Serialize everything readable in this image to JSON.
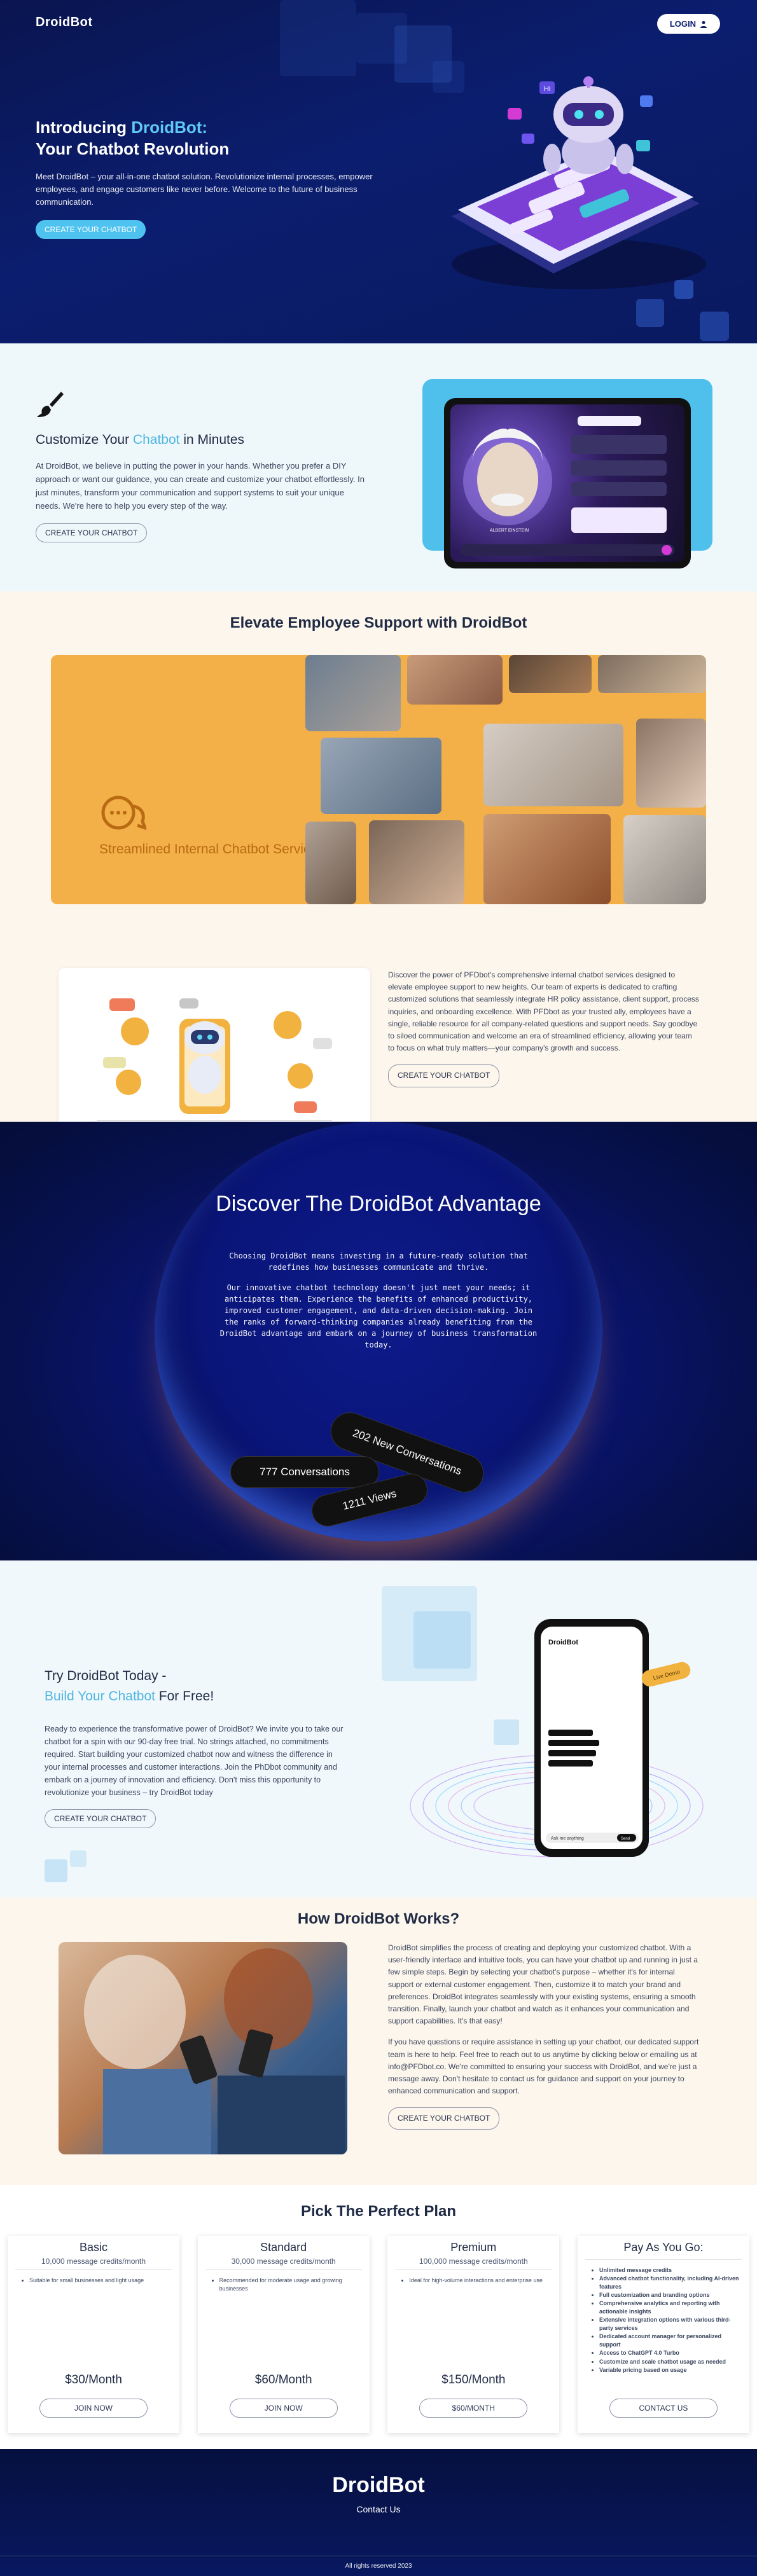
{
  "header": {
    "brand": "DroidBot",
    "login_label": "LOGIN",
    "login_icon": "user-icon"
  },
  "hero": {
    "title_line1_prefix": "Introducing ",
    "title_line1_accent": "DroidBot:",
    "title_line2": "Your Chatbot Revolution",
    "description": "Meet DroidBot – your all-in-one chatbot solution. Revolutionize internal processes, empower employees, and engage customers like never before. Welcome to the future of business communication.",
    "cta_label": "CREATE YOUR CHATBOT",
    "chat_badge": "Hi"
  },
  "customize": {
    "title_prefix": "Customize Your ",
    "title_accent": "Chatbot",
    "title_suffix": " in Minutes",
    "description": "At DroidBot, we believe in putting the power in your hands. Whether you prefer a DIY approach or want our guidance, you can create and customize your chatbot effortlessly. In just minutes, transform your communication and support systems to suit your unique needs. We're here to help you every step of the way.",
    "cta_label": "CREATE YOUR CHATBOT",
    "mock_name": "ALBERT EINSTEIN"
  },
  "elevate": {
    "title": "Elevate Employee Support with DroidBot",
    "card_title": "Streamlined Internal Chatbot Services",
    "description": "Discover the power of PFDbot's comprehensive internal chatbot services designed to elevate employee support to new heights. Our team of experts is dedicated to crafting customized solutions that seamlessly integrate HR policy assistance, client support, process inquiries, and onboarding excellence. With PFDbot as your trusted ally, employees have a single, reliable resource for all company-related questions and support needs. Say goodbye to siloed communication and welcome an era of streamlined efficiency, allowing your team to focus on what truly matters—your company's growth and success.",
    "cta_label": "CREATE YOUR CHATBOT"
  },
  "discover": {
    "title": "Discover The DroidBot Advantage",
    "paragraph1": "Choosing DroidBot means investing in a future-ready solution that redefines how businesses communicate and thrive.",
    "paragraph2": "Our innovative chatbot technology doesn't just meet your needs; it anticipates them. Experience the benefits of enhanced productivity, improved customer engagement, and data-driven decision-making. Join the ranks of forward-thinking companies already benefiting from the DroidBot advantage and embark on a journey of business transformation today.",
    "stat_conversations": "202 New Conversations",
    "stat_total": "777 Conversations",
    "stat_views": "1211 Views"
  },
  "try": {
    "title_line1": "Try DroidBot Today -",
    "title_accent": "Build Your Chatbot",
    "title_suffix": " For Free!",
    "description": "Ready to experience the transformative power of DroidBot? We invite you to take our chatbot for a spin with our 90-day free trial. No strings attached, no commitments required. Start building your customized chatbot now and witness the difference in your internal processes and customer interactions. Join the PhDbot community and embark on a journey of innovation and efficiency. Don't miss this opportunity to revolutionize your business – try DroidBot today",
    "cta_label": "CREATE YOUR CHATBOT",
    "phone_brand": "DroidBot",
    "phone_badge": "Live Demo",
    "phone_input": "Ask me anything",
    "phone_send": "Send"
  },
  "how": {
    "title": "How DroidBot Works?",
    "paragraph1": "DroidBot simplifies the process of creating and deploying your customized chatbot. With a user-friendly interface and intuitive tools, you can have your chatbot up and running in just a few simple steps. Begin by selecting your chatbot's purpose – whether it's for internal support or external customer engagement. Then, customize it to match your brand and preferences. DroidBot integrates seamlessly with your existing systems, ensuring a smooth transition. Finally, launch your chatbot and watch as it enhances your communication and support capabilities. It's that easy!",
    "paragraph2": "If you have questions or require assistance in setting up your chatbot, our dedicated support team is here to help. Feel free to reach out to us anytime by clicking below or emailing us at info@PFDbot.co. We're committed to ensuring your success with DroidBot, and we're just a message away. Don't hesitate to contact us for guidance and support on your journey to enhanced communication and support.",
    "cta_label": "CREATE YOUR CHATBOT"
  },
  "pricing": {
    "title": "Pick The Perfect Plan",
    "plans": [
      {
        "name": "Basic",
        "credits": "10,000 message credits/month",
        "features": [
          "Suitable for small businesses and light usage"
        ],
        "price": "$30/Month",
        "button": "JOIN NOW"
      },
      {
        "name": "Standard",
        "credits": "30,000 message credits/month",
        "features": [
          "Recommended for moderate usage and growing businesses"
        ],
        "price": "$60/Month",
        "button": "JOIN NOW"
      },
      {
        "name": "Premium",
        "credits": "100,000 message credits/month",
        "features": [
          "Ideal for high-volume interactions and enterprise use"
        ],
        "price": "$150/Month",
        "button": "$60/MONTH"
      },
      {
        "name": "Pay As You Go:",
        "credits": "",
        "features": [
          "Unlimited message credits",
          "Advanced chatbot functionality, including AI-driven features",
          "Full customization and branding options",
          "Comprehensive analytics and reporting with actionable insights",
          "Extensive integration options with various third-party services",
          "Dedicated account manager for personalized support",
          "Access to ChatGPT 4.0 Turbo",
          "Customize and scale chatbot usage as needed",
          "Variable pricing based on usage"
        ],
        "price": "",
        "button": "CONTACT US"
      }
    ]
  },
  "footer": {
    "brand": "DroidBot",
    "contact": "Contact Us",
    "rights": "All rights reserved 2023"
  },
  "colors": {
    "navy": "#0b1d6e",
    "accent_cyan": "#4fc3f0",
    "orange": "#f3b048",
    "cream": "#fdf6ec",
    "light_blue_bg": "#eef8fb"
  }
}
